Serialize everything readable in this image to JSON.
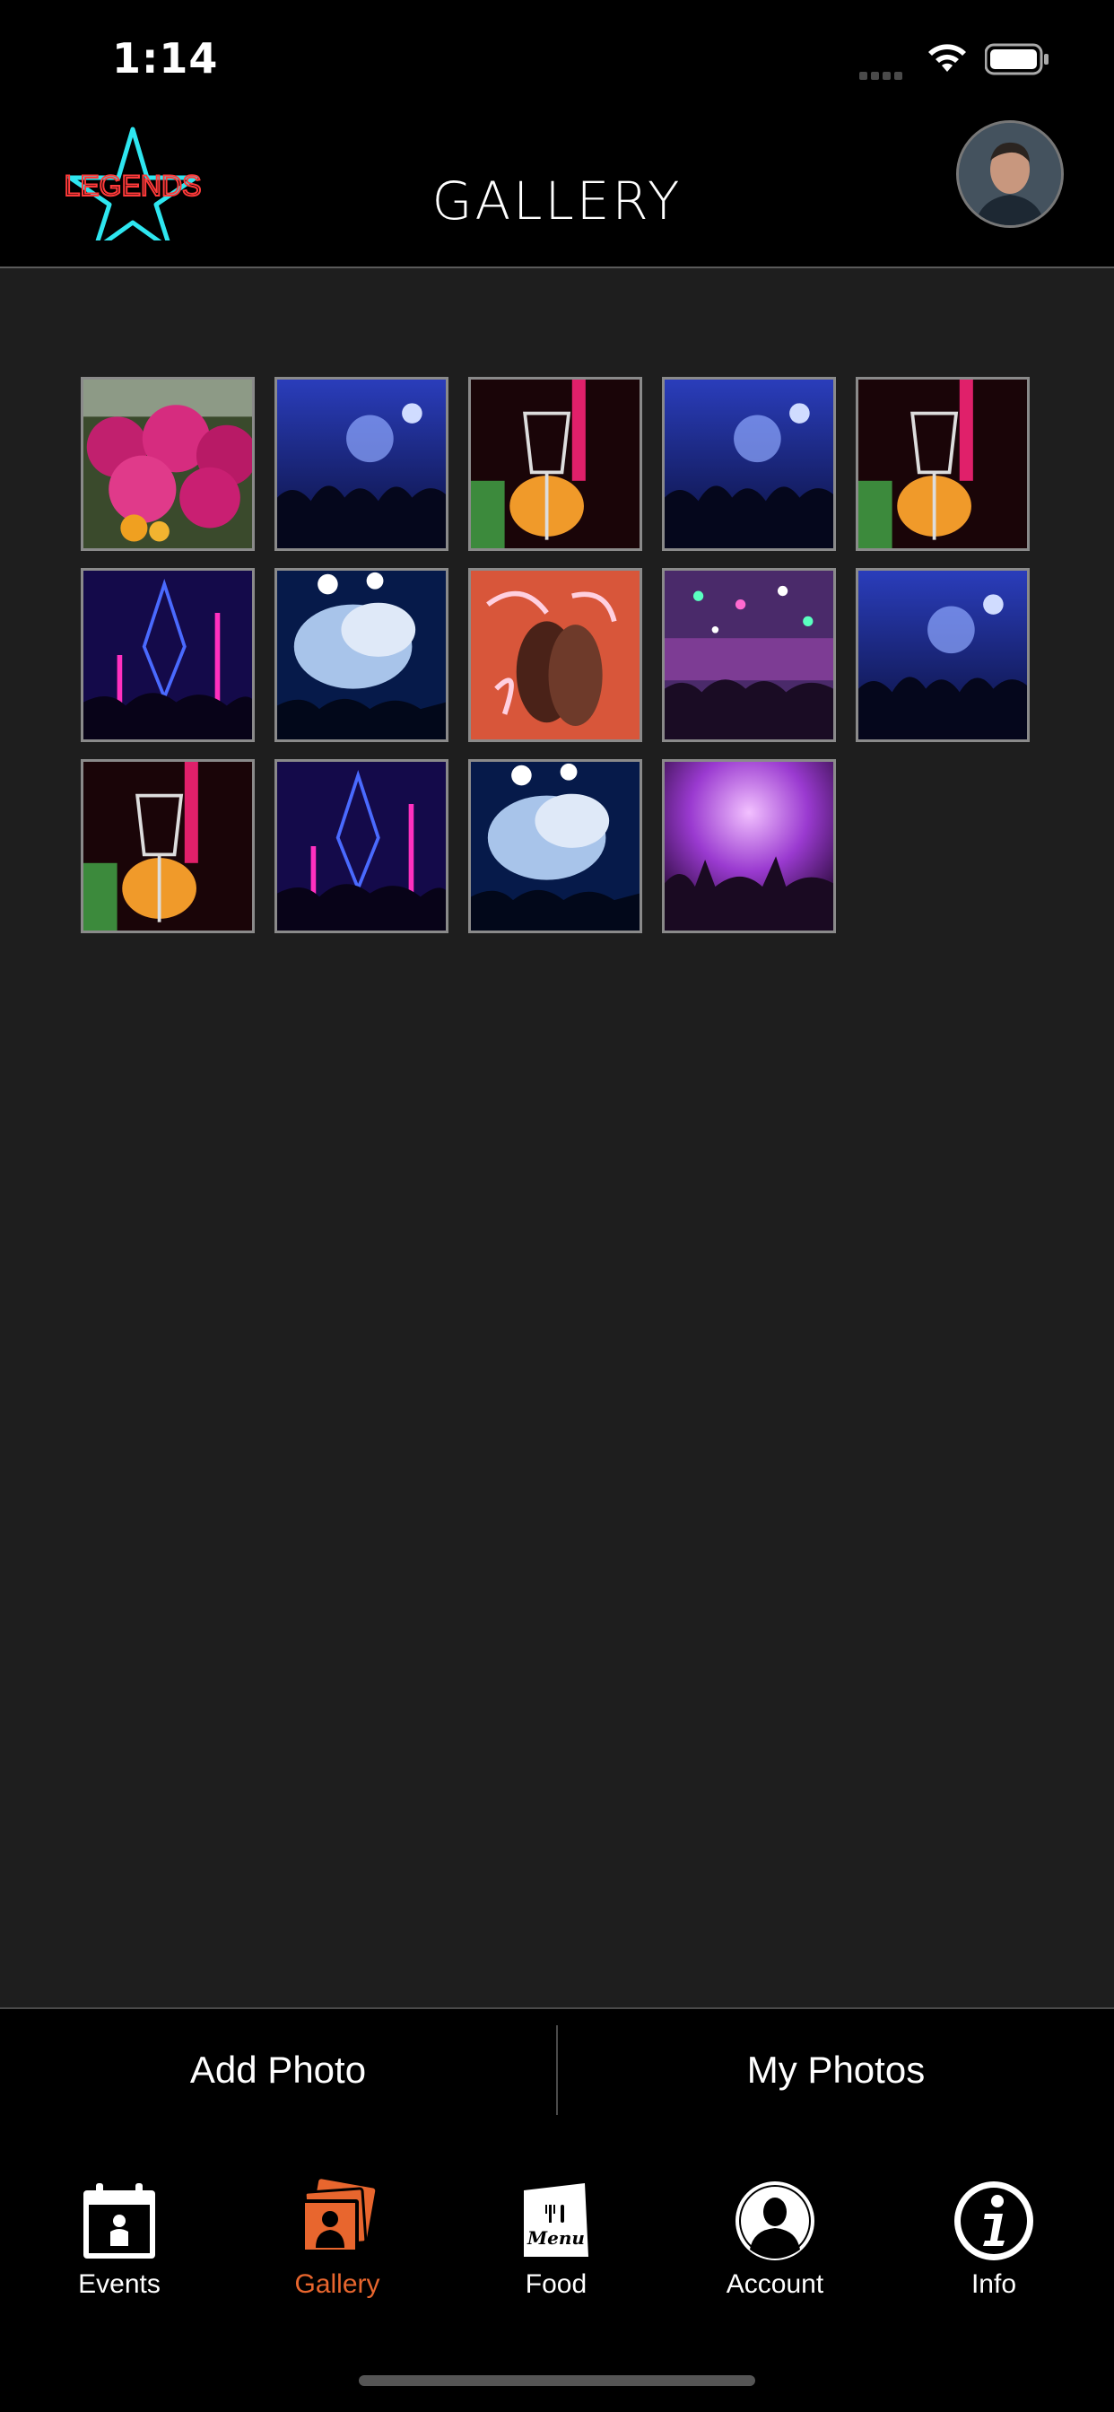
{
  "status_bar": {
    "time": "1:14"
  },
  "header": {
    "title": "GALLERY",
    "logo_text": "LEGENDS"
  },
  "gallery": {
    "photos": [
      {
        "name": "flowers"
      },
      {
        "name": "crowd-blue"
      },
      {
        "name": "wine-glasses"
      },
      {
        "name": "crowd-blue"
      },
      {
        "name": "wine-glasses"
      },
      {
        "name": "neon-diamond"
      },
      {
        "name": "smoke-cloud"
      },
      {
        "name": "neon-couple"
      },
      {
        "name": "confetti-crowd"
      },
      {
        "name": "crowd-blue"
      },
      {
        "name": "wine-glasses"
      },
      {
        "name": "neon-diamond"
      },
      {
        "name": "smoke-cloud"
      },
      {
        "name": "purple-concert"
      }
    ]
  },
  "actions": {
    "add_photo": "Add Photo",
    "my_photos": "My Photos"
  },
  "tabs": [
    {
      "label": "Events",
      "icon": "calendar-icon",
      "active": false
    },
    {
      "label": "Gallery",
      "icon": "photos-icon",
      "active": true
    },
    {
      "label": "Food",
      "icon": "menu-icon",
      "active": false
    },
    {
      "label": "Account",
      "icon": "account-icon",
      "active": false
    },
    {
      "label": "Info",
      "icon": "info-icon",
      "active": false
    }
  ],
  "colors": {
    "accent": "#e8662e",
    "background": "#1e1e1e",
    "bar": "#000000"
  }
}
